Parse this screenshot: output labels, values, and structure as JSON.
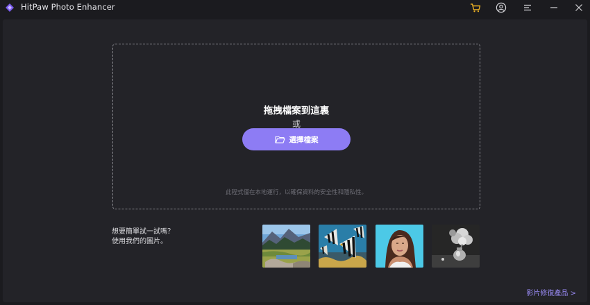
{
  "window": {
    "title": "HitPaw Photo Enhancer",
    "icons": [
      "cart-icon",
      "account-icon",
      "menu-icon",
      "minimize-icon",
      "close-icon"
    ]
  },
  "dropzone": {
    "title": "拖拽檔案到這裏",
    "or_text": "或",
    "select_button_label": "選擇檔案",
    "privacy_note": "此程式僅在本地運行，以確保資料的安全性和隱私性。"
  },
  "samples": {
    "prompt_line1": "想要簡單試一試嗎？",
    "prompt_line2": "使用我們的圖片。",
    "images": [
      "landscape-sample",
      "zebra-fish-sample",
      "portrait-sample",
      "flower-vase-sample"
    ]
  },
  "footer": {
    "video_link": "影片修復產品 >"
  },
  "colors": {
    "accent": "#8d7cf4",
    "background": "#1b1b1f",
    "panel": "#232328",
    "cart": "#f0b323"
  }
}
